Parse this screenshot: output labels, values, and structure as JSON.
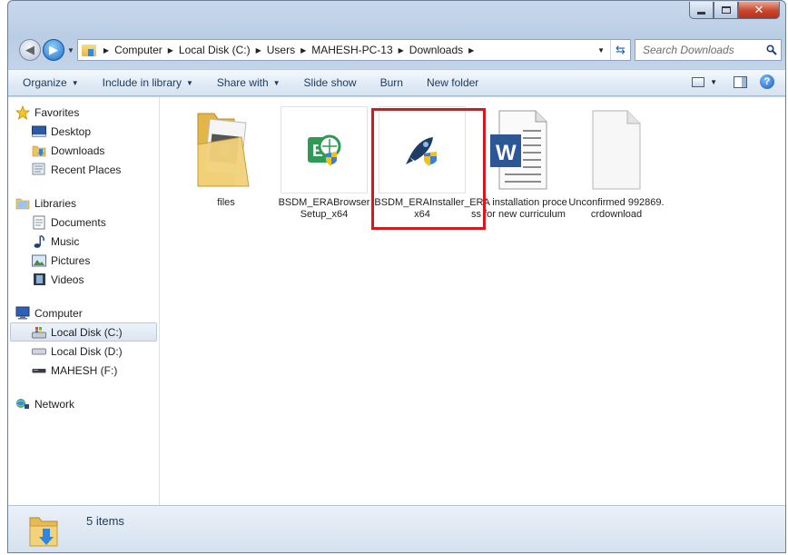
{
  "window": {
    "caption_buttons": [
      "minimize",
      "maximize",
      "close"
    ]
  },
  "address": {
    "crumbs": [
      "Computer",
      "Local Disk (C:)",
      "Users",
      "MAHESH-PC-13",
      "Downloads"
    ],
    "search_placeholder": "Search Downloads"
  },
  "toolbar": {
    "organize": "Organize",
    "include_in_library": "Include in library",
    "share_with": "Share with",
    "slide_show": "Slide show",
    "burn": "Burn",
    "new_folder": "New folder"
  },
  "nav": {
    "favorites": "Favorites",
    "desktop": "Desktop",
    "downloads": "Downloads",
    "recent_places": "Recent Places",
    "libraries": "Libraries",
    "documents": "Documents",
    "music": "Music",
    "pictures": "Pictures",
    "videos": "Videos",
    "computer": "Computer",
    "local_c": "Local Disk (C:)",
    "local_d": "Local Disk (D:)",
    "mahesh_f": "MAHESH (F:)",
    "network": "Network"
  },
  "files": [
    {
      "name": "files",
      "icon": "folder-icon"
    },
    {
      "name": "BSDM_ERABrowserSetup_x64",
      "icon": "browser-setup-icon"
    },
    {
      "name": "BSDM_ERAInstaller_x64",
      "icon": "installer-icon"
    },
    {
      "name": "ERA installation process for new curriculum",
      "icon": "word-document-icon"
    },
    {
      "name": "Unconfirmed 992869.crdownload",
      "icon": "blank-file-icon"
    }
  ],
  "status": {
    "item_count": "5 items"
  },
  "colors": {
    "highlight": "#e0141a",
    "toolbar_text": "#1e395b"
  }
}
